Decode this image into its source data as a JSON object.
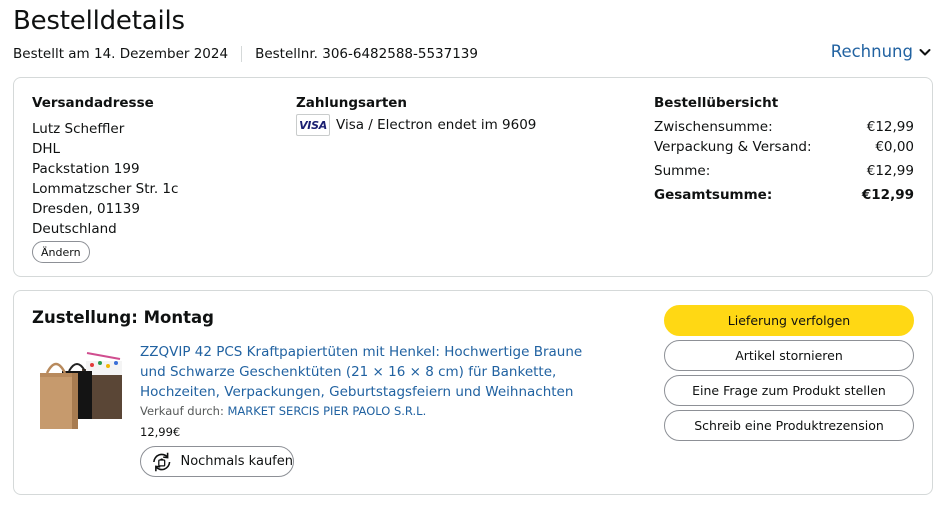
{
  "page": {
    "title": "Bestelldetails",
    "ordered_on": "Bestellt am 14. Dezember 2024",
    "order_number": "Bestellnr. 306-6482588-5537139",
    "invoice_label": "Rechnung"
  },
  "shipping": {
    "title": "Versandadresse",
    "lines": [
      "Lutz Scheffler",
      "DHL",
      "Packstation 199",
      "Lommatzscher Str. 1c",
      "Dresden, 01139",
      "Deutschland"
    ],
    "change_label": "Ändern"
  },
  "payment": {
    "title": "Zahlungsarten",
    "card_logo": "VISA",
    "card_text": "Visa / Electron",
    "ending": "endet im 9609"
  },
  "summary": {
    "title": "Bestellübersicht",
    "rows": [
      {
        "label": "Zwischensumme:",
        "value": "€12,99"
      },
      {
        "label": "Verpackung & Versand:",
        "value": "€0,00"
      },
      {
        "label": "Summe:",
        "value": "€12,99"
      },
      {
        "label": "Gesamtsumme:",
        "value": "€12,99"
      }
    ]
  },
  "delivery": {
    "title": "Zustellung: Montag",
    "product_title": "ZZQVIP 42 PCS Kraftpapiertüten mit Henkel: Hochwertige Braune und Schwarze Geschenktüten (21 × 16 × 8 cm) für Bankette, Hochzeiten, Verpackungen, Geburtstagsfeiern und Weihnachten",
    "sold_by_label": "Verkauf durch:",
    "seller": "MARKET SERCIS PIER PAOLO S.R.L.",
    "price": "12,99€",
    "buy_again_label": "Nochmals kaufen"
  },
  "actions": {
    "track": "Lieferung verfolgen",
    "cancel": "Artikel stornieren",
    "question": "Eine Frage zum Produkt stellen",
    "review": "Schreib eine Produktrezension"
  },
  "colors": {
    "link": "#2162a1",
    "primary_button": "#ffd814",
    "border": "#d5d9d9"
  },
  "icons": {
    "invoice": "chevron-down-icon",
    "buy_again": "buy-again-icon"
  }
}
